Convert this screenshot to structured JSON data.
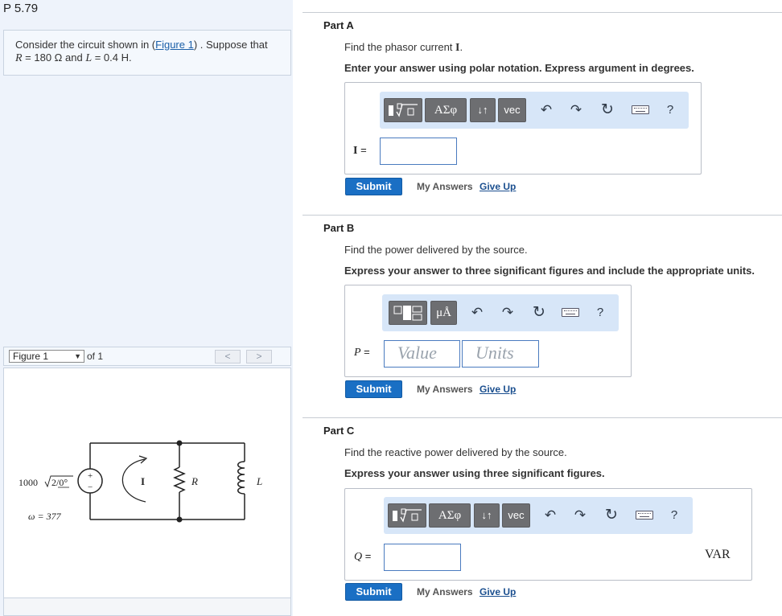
{
  "problem": {
    "title": "P 5.79",
    "text_prefix": "Consider the circuit shown in (",
    "figure_link": "Figure 1",
    "text_suffix": ") . Suppose that",
    "r_var": "R",
    "r_value": " = 180 Ω and ",
    "l_var": "L",
    "l_value": " = 0.4 H."
  },
  "figure_nav": {
    "selected": "Figure 1",
    "of_label": "of 1",
    "prev": "<",
    "next": ">"
  },
  "circuit": {
    "source_value": "1000",
    "source_angle": "2/0°",
    "omega_label": "ω = 377",
    "current_label": "I",
    "resistor_label": "R",
    "inductor_label": "L",
    "plus": "+",
    "minus": "−"
  },
  "part_a": {
    "title": "Part A",
    "find": "Find the phasor current ",
    "find_var": "I",
    "find_end": ".",
    "instruction": "Enter your answer using polar notation. Express argument in degrees.",
    "var_label": "I",
    "eq": " =",
    "sym_button": "ΑΣφ",
    "arrows_button": "↓↑",
    "vec_button": "vec",
    "help": "?",
    "submit": "Submit",
    "my_answers": "My Answers",
    "give_up": "Give Up"
  },
  "part_b": {
    "title": "Part B",
    "find": "Find the power delivered by the source.",
    "instruction": "Express your answer to three significant figures and include the appropriate units.",
    "var_label": "P",
    "eq": " =",
    "unit_button": "μÅ",
    "value_placeholder": "Value",
    "units_placeholder": "Units",
    "help": "?",
    "submit": "Submit",
    "my_answers": "My Answers",
    "give_up": "Give Up"
  },
  "part_c": {
    "title": "Part C",
    "find": "Find the reactive power delivered by the source.",
    "instruction": "Express your answer using three significant figures.",
    "var_label": "Q",
    "eq": " =",
    "sym_button": "ΑΣφ",
    "arrows_button": "↓↑",
    "vec_button": "vec",
    "help": "?",
    "unit": "VAR",
    "submit": "Submit",
    "my_answers": "My Answers",
    "give_up": "Give Up"
  }
}
